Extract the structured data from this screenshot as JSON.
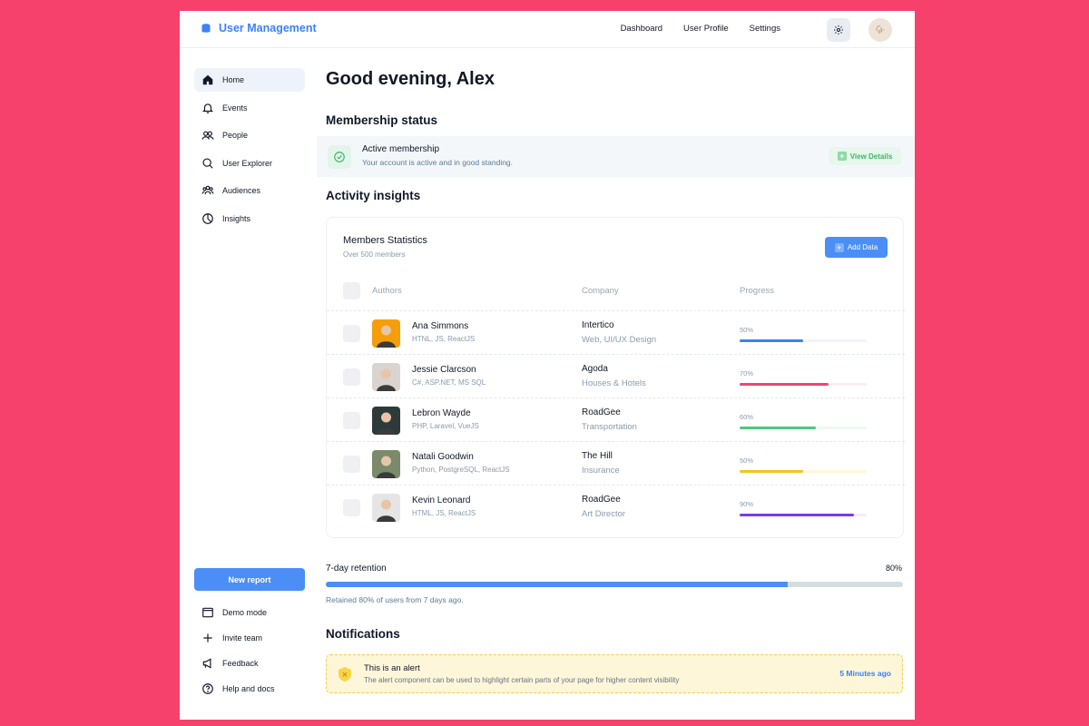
{
  "header": {
    "brand": "User Management",
    "nav": [
      "Dashboard",
      "User Profile",
      "Settings"
    ]
  },
  "sidebar": {
    "items": [
      {
        "label": "Home",
        "icon": "home-icon"
      },
      {
        "label": "Events",
        "icon": "bell-icon"
      },
      {
        "label": "People",
        "icon": "people-icon"
      },
      {
        "label": "User Explorer",
        "icon": "search-icon"
      },
      {
        "label": "Audiences",
        "icon": "audience-icon"
      },
      {
        "label": "Insights",
        "icon": "pie-chart-icon"
      }
    ],
    "new_report": "New report",
    "bottom": [
      {
        "label": "Demo mode",
        "icon": "window-icon"
      },
      {
        "label": "Invite team",
        "icon": "plus-icon"
      },
      {
        "label": "Feedback",
        "icon": "megaphone-icon"
      },
      {
        "label": "Help and docs",
        "icon": "help-icon"
      }
    ]
  },
  "main": {
    "greeting": "Good evening, Alex",
    "membership_heading": "Membership status",
    "membership": {
      "title": "Active membership",
      "subtitle": "Your account is active and in good standing.",
      "button": "View Details"
    },
    "activity_heading": "Activity insights",
    "card": {
      "title": "Members Statistics",
      "subtitle": "Over 500 members",
      "add_button": "Add Data",
      "columns": [
        "Authors",
        "Company",
        "Progress"
      ],
      "rows": [
        {
          "name": "Ana Simmons",
          "skills": "HTNL, JS, ReactJS",
          "company": "Intertico",
          "company_sub": "Web, UI/UX Design",
          "progress": "50%",
          "value": 0.5,
          "color": "#3b82f6",
          "track": "#eef5fd",
          "face_bg": "#f59e0b"
        },
        {
          "name": "Jessie Clarcson",
          "skills": "C#, ASP.NET, MS SQL",
          "company": "Agoda",
          "company_sub": "Houses & Hotels",
          "progress": "70%",
          "value": 0.7,
          "color": "#ef476f",
          "track": "#fdeef1",
          "face_bg": "#d9d4cf"
        },
        {
          "name": "Lebron Wayde",
          "skills": "PHP, Laravel, VueJS",
          "company": "RoadGee",
          "company_sub": "Transportation",
          "progress": "60%",
          "value": 0.6,
          "color": "#4cc97e",
          "track": "#ecf9f1",
          "face_bg": "#2e3a3a"
        },
        {
          "name": "Natali Goodwin",
          "skills": "Python, PostgreSQL, ReactJS",
          "company": "The Hill",
          "company_sub": "Insurance",
          "progress": "50%",
          "value": 0.5,
          "color": "#f5c518",
          "track": "#fdf7dc",
          "face_bg": "#7a8a6a"
        },
        {
          "name": "Kevin Leonard",
          "skills": "HTML, JS, ReactJS",
          "company": "RoadGee",
          "company_sub": "Art Director",
          "progress": "90%",
          "value": 0.9,
          "color": "#7c3aed",
          "track": "#f2ecfd",
          "face_bg": "#e5e5e5"
        }
      ]
    },
    "retention": {
      "label": "7-day retention",
      "percent": "80%",
      "value": 0.8,
      "subtitle": "Retained 80% of users from 7 days ago."
    },
    "notifications_heading": "Notifications",
    "alert": {
      "title": "This is an alert",
      "subtitle": "The alert component can be used to highlight certain parts of your page for higher content visibility",
      "time": "5 Minutes ago"
    }
  }
}
